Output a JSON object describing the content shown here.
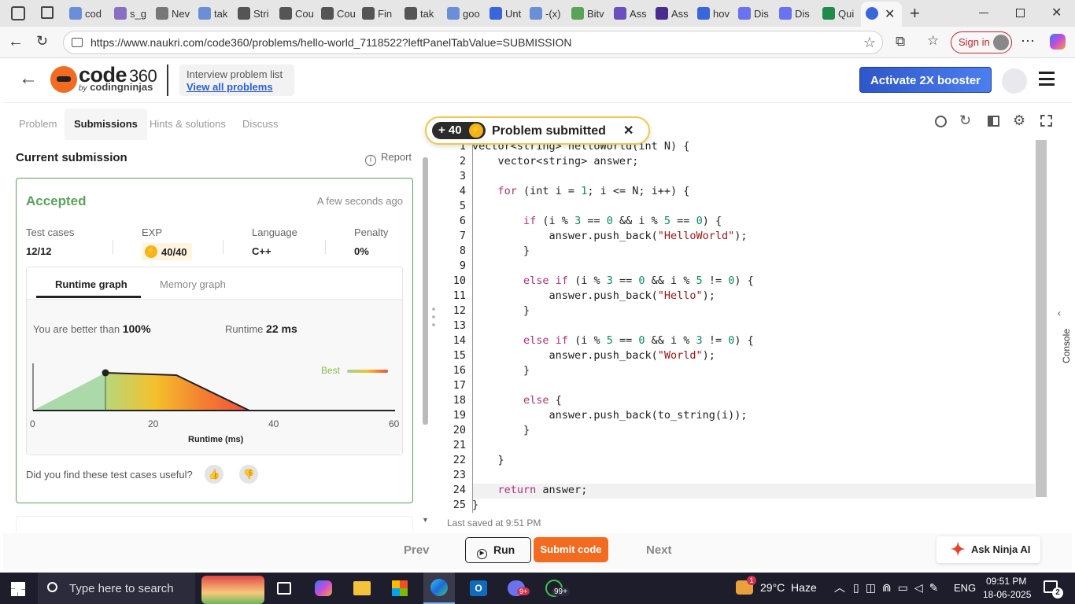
{
  "browser": {
    "tabs": [
      "cod",
      "s_g",
      "Nev",
      "tak",
      "Stri",
      "Cou",
      "Cou",
      "Fin",
      "tak",
      "goo",
      "Unt",
      "-(x)",
      "Bitv",
      "Ass",
      "Ass",
      "hov",
      "Dis",
      "Dis",
      "Qui"
    ],
    "url": "https://www.naukri.com/code360/problems/hello-world_7118522?leftPanelTabValue=SUBMISSION",
    "signin": "Sign in"
  },
  "header": {
    "logo_main": "code",
    "logo_num": "360",
    "logo_by": "by",
    "logo_sub": "codingninjas",
    "problem_list_title": "Interview problem list",
    "view_all": "View all problems",
    "booster": "Activate 2X booster"
  },
  "left_tabs": [
    "Problem",
    "Submissions",
    "Hints & solutions",
    "Discuss"
  ],
  "submission": {
    "title": "Current submission",
    "report": "Report",
    "status": "Accepted",
    "time": "A few seconds ago",
    "test_cases_label": "Test cases",
    "test_cases": "12/12",
    "exp_label": "EXP",
    "exp": "40/40",
    "language_label": "Language",
    "language": "C++",
    "penalty_label": "Penalty",
    "penalty": "0%",
    "graph_tabs": [
      "Runtime graph",
      "Memory graph"
    ],
    "better_label": "You are better than",
    "better_value": "100%",
    "runtime_label": "Runtime",
    "runtime_value": "22 ms",
    "best_label": "Best",
    "useful_q": "Did you find these test cases useful?"
  },
  "chart_data": {
    "type": "area",
    "xlabel": "Runtime (ms)",
    "x_ticks": [
      "0",
      "20",
      "40",
      "60"
    ],
    "xlim": [
      0,
      60
    ],
    "marker_x": 12,
    "legend": "Best"
  },
  "toast": {
    "points": "+ 40",
    "message": "Problem submitted"
  },
  "editor": {
    "line_numbers": [
      "1",
      "2",
      "3",
      "4",
      "5",
      "6",
      "7",
      "8",
      "9",
      "10",
      "11",
      "12",
      "13",
      "14",
      "15",
      "16",
      "17",
      "18",
      "19",
      "20",
      "21",
      "22",
      "23",
      "24",
      "25"
    ],
    "last_saved": "Last saved at 9:51 PM",
    "console": "Console"
  },
  "bottom": {
    "prev": "Prev",
    "run": "Run",
    "submit": "Submit code",
    "next": "Next",
    "ask_ai": "Ask Ninja AI"
  },
  "taskbar": {
    "search": "Type here to search",
    "weather": "29°C  Haze",
    "lang": "ENG",
    "time": "09:51 PM",
    "date": "18-06-2025",
    "whatsapp_badge": "99+",
    "discord_badge": "9+",
    "notif": "2",
    "weather_badge": "1"
  },
  "colors": {
    "accent": "#f26b21",
    "accepted": "#5aa45a",
    "booster": "#3a66dc"
  }
}
